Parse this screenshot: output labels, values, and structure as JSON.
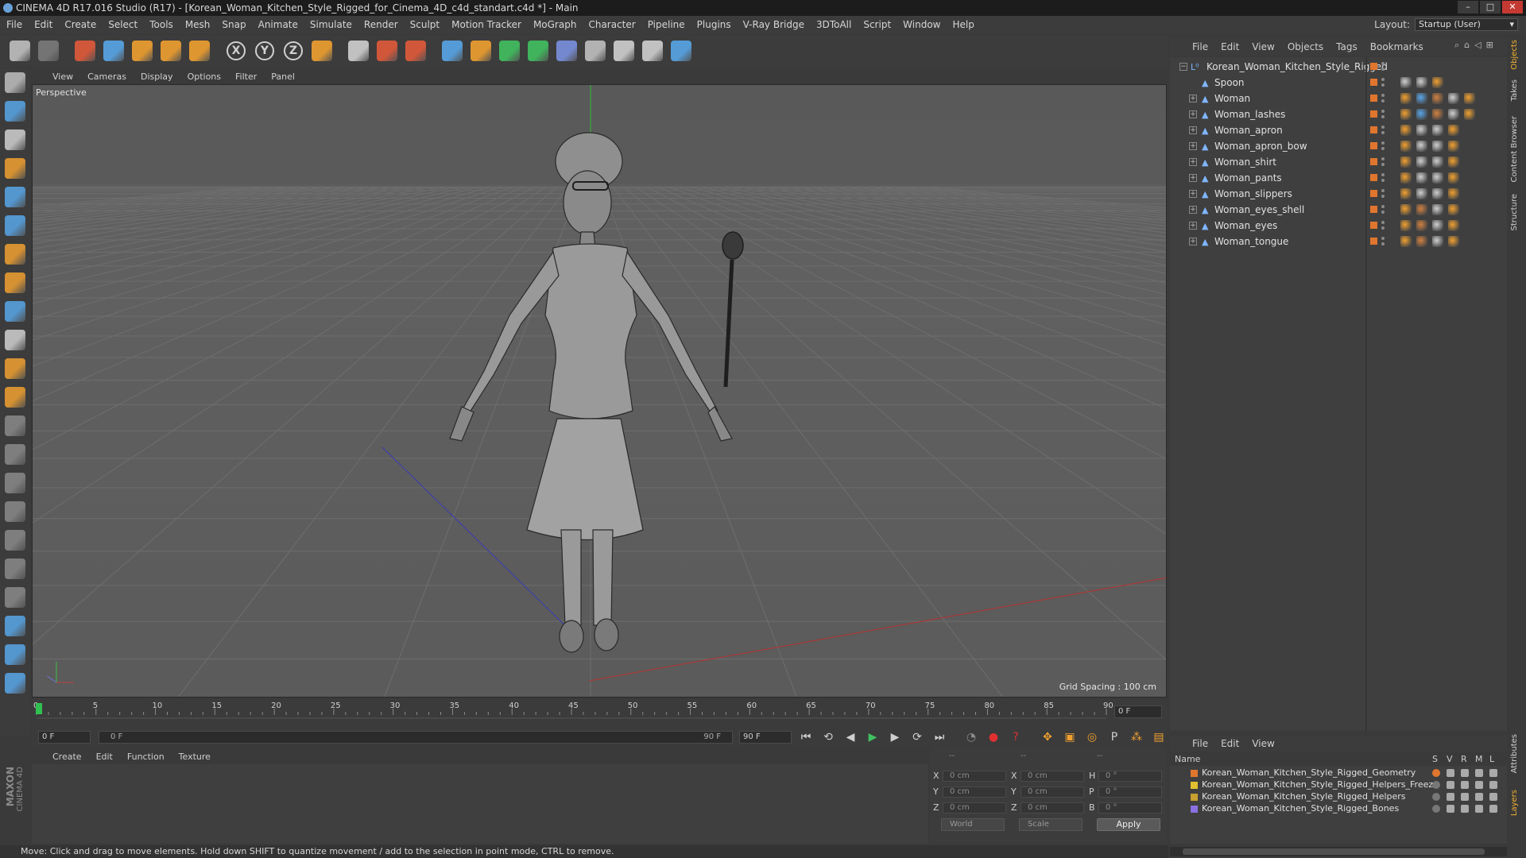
{
  "window": {
    "title": "CINEMA 4D R17.016 Studio (R17) - [Korean_Woman_Kitchen_Style_Rigged_for_Cinema_4D_c4d_standart.c4d *] - Main",
    "controls": [
      "minimize-icon",
      "maximize-icon",
      "close-icon"
    ]
  },
  "menubar": {
    "items": [
      "File",
      "Edit",
      "Create",
      "Select",
      "Tools",
      "Mesh",
      "Snap",
      "Animate",
      "Simulate",
      "Render",
      "Sculpt",
      "Motion Tracker",
      "MoGraph",
      "Character",
      "Pipeline",
      "Plugins",
      "V-Ray Bridge",
      "3DToAll",
      "Script",
      "Window",
      "Help"
    ],
    "layout_label": "Layout:",
    "layout_value": "Startup (User)"
  },
  "toolbar": {
    "tools": [
      {
        "name": "undo-icon",
        "color": "#bfbfbf"
      },
      {
        "name": "redo-icon",
        "color": "#7a7a7a"
      },
      {
        "name": "live-selection-icon",
        "color": "#e05a3a"
      },
      {
        "name": "move-icon",
        "color": "#58a6e8"
      },
      {
        "name": "scale-icon",
        "color": "#f0a030"
      },
      {
        "name": "rotate-icon",
        "color": "#f0a030"
      },
      {
        "name": "transform-icon",
        "color": "#f0a030"
      },
      {
        "name": "x-axis-icon",
        "color": "#d0d0d0",
        "glyph": "X"
      },
      {
        "name": "y-axis-icon",
        "color": "#d0d0d0",
        "glyph": "Y"
      },
      {
        "name": "z-axis-icon",
        "color": "#d0d0d0",
        "glyph": "Z"
      },
      {
        "name": "coordinate-system-icon",
        "color": "#f0a030"
      },
      {
        "name": "render-view-icon",
        "color": "#d0d0d0"
      },
      {
        "name": "render-picture-viewer-icon",
        "color": "#e05a3a"
      },
      {
        "name": "render-settings-icon",
        "color": "#e05a3a"
      },
      {
        "name": "cube-icon",
        "color": "#58a6e8"
      },
      {
        "name": "pen-spline-icon",
        "color": "#f0a030"
      },
      {
        "name": "subdivision-icon",
        "color": "#40c060"
      },
      {
        "name": "cloner-icon",
        "color": "#40c060"
      },
      {
        "name": "deformer-icon",
        "color": "#7a90e0"
      },
      {
        "name": "floor-icon",
        "color": "#bfbfbf"
      },
      {
        "name": "camera-icon",
        "color": "#d0d0d0"
      },
      {
        "name": "light-icon",
        "color": "#d0d0d0"
      },
      {
        "name": "python-icon",
        "color": "#58a6e8"
      }
    ]
  },
  "left_toolbar": {
    "tools": [
      {
        "name": "make-editable-icon",
        "color": "#bfbfbf"
      },
      {
        "name": "model-mode-icon",
        "color": "#58a6e8"
      },
      {
        "name": "texture-mode-icon",
        "color": "#d0d0d0"
      },
      {
        "name": "workplane-mode-icon",
        "color": "#f0a030"
      },
      {
        "name": "points-mode-icon",
        "color": "#58a6e8"
      },
      {
        "name": "edges-mode-icon",
        "color": "#58a6e8"
      },
      {
        "name": "polygons-mode-icon",
        "color": "#f0a030"
      },
      {
        "name": "axis-mode-icon",
        "color": "#f0a030"
      },
      {
        "name": "tweak-mode-icon",
        "color": "#58a6e8"
      },
      {
        "name": "snapping-icon",
        "color": "#d0d0d0"
      },
      {
        "name": "magnet-icon",
        "color": "#f0a030"
      },
      {
        "name": "joint-tool-icon",
        "color": "#f0a030"
      },
      {
        "name": "bone-tool-1-icon",
        "color": "#8a8a8a"
      },
      {
        "name": "bone-tool-2-icon",
        "color": "#8a8a8a"
      },
      {
        "name": "bone-tool-3-icon",
        "color": "#8a8a8a"
      },
      {
        "name": "bone-tool-4-icon",
        "color": "#8a8a8a"
      },
      {
        "name": "bone-tool-5-icon",
        "color": "#8a8a8a"
      },
      {
        "name": "bone-tool-6-icon",
        "color": "#8a8a8a"
      },
      {
        "name": "bone-tool-7-icon",
        "color": "#8a8a8a"
      },
      {
        "name": "lock-workplane-icon",
        "color": "#58a6e8"
      },
      {
        "name": "planar-workplane-icon",
        "color": "#58a6e8"
      },
      {
        "name": "python-script-icon",
        "color": "#58a6e8"
      }
    ]
  },
  "viewport": {
    "menu": [
      "View",
      "Cameras",
      "Display",
      "Options",
      "Filter",
      "Panel"
    ],
    "label": "Perspective",
    "grid_spacing": "Grid Spacing : 100 cm"
  },
  "timeline": {
    "ticks": [
      "0",
      "5",
      "10",
      "15",
      "20",
      "25",
      "30",
      "35",
      "40",
      "45",
      "50",
      "55",
      "60",
      "65",
      "70",
      "75",
      "80",
      "85",
      "90"
    ],
    "current_frame": "0 F",
    "start_field": "0 F",
    "range_start": "0 F",
    "range_end": "90 F",
    "end_field": "90 F",
    "playhead": 0,
    "max_frame": 90
  },
  "playback": {
    "buttons": [
      {
        "name": "go-to-start-icon",
        "color": "#cfcfcf",
        "glyph": "⏮"
      },
      {
        "name": "previous-key-icon",
        "color": "#cfcfcf",
        "glyph": "⟲"
      },
      {
        "name": "previous-frame-icon",
        "color": "#cfcfcf",
        "glyph": "◀"
      },
      {
        "name": "play-forward-icon",
        "color": "#40c060",
        "glyph": "▶"
      },
      {
        "name": "next-frame-icon",
        "color": "#cfcfcf",
        "glyph": "▶"
      },
      {
        "name": "next-key-icon",
        "color": "#cfcfcf",
        "glyph": "⟳"
      },
      {
        "name": "go-to-end-icon",
        "color": "#cfcfcf",
        "glyph": "⏭"
      },
      {
        "name": "record-motion-icon",
        "color": "#8a8a8a",
        "glyph": "◔"
      },
      {
        "name": "record-active-icon",
        "color": "#e03030",
        "glyph": "●"
      },
      {
        "name": "autokeying-icon",
        "color": "#e03030",
        "glyph": "?"
      },
      {
        "name": "key-position-icon",
        "color": "#f0a030",
        "glyph": "✥"
      },
      {
        "name": "key-scale-icon",
        "color": "#f0a030",
        "glyph": "▣"
      },
      {
        "name": "key-rotation-icon",
        "color": "#f0a030",
        "glyph": "◎"
      },
      {
        "name": "key-parameter-icon",
        "color": "#d0d0d0",
        "glyph": "P"
      },
      {
        "name": "key-pla-icon",
        "color": "#f0a030",
        "glyph": "⁂"
      },
      {
        "name": "timeline-window-icon",
        "color": "#f0a030",
        "glyph": "▤"
      }
    ]
  },
  "material": {
    "menu": [
      "Create",
      "Edit",
      "Function",
      "Texture"
    ]
  },
  "coordinates": {
    "headers": [
      "--",
      "--",
      "--"
    ],
    "rows": [
      {
        "l1": "X",
        "v1": "0 cm",
        "l2": "X",
        "v2": "0 cm",
        "l3": "H",
        "v3": "0 °"
      },
      {
        "l1": "Y",
        "v1": "0 cm",
        "l2": "Y",
        "v2": "0 cm",
        "l3": "P",
        "v3": "0 °"
      },
      {
        "l1": "Z",
        "v1": "0 cm",
        "l2": "Z",
        "v2": "0 cm",
        "l3": "B",
        "v3": "0 °"
      }
    ],
    "space": "World",
    "mode": "Scale",
    "apply": "Apply"
  },
  "status": {
    "text": "Move: Click and drag to move elements. Hold down SHIFT to quantize movement / add to the selection in point mode, CTRL to remove."
  },
  "logo": {
    "line1": "MAXON",
    "line2": "CINEMA 4D"
  },
  "object_manager": {
    "menu": [
      "File",
      "Edit",
      "View",
      "Objects",
      "Tags",
      "Bookmarks"
    ],
    "root": "Korean_Woman_Kitchen_Style_Rigged",
    "objects": [
      {
        "name": "Spoon",
        "expandable": false,
        "tags": [
          "#d0d0d0",
          "#d0d0d0",
          "#f0a030"
        ]
      },
      {
        "name": "Woman",
        "expandable": true,
        "tags": [
          "#f0a030",
          "#58a6e8",
          "#d08040",
          "#d0d0d0",
          "#f0a030"
        ]
      },
      {
        "name": "Woman_lashes",
        "expandable": true,
        "tags": [
          "#f0a030",
          "#58a6e8",
          "#d08040",
          "#d0d0d0",
          "#f0a030"
        ]
      },
      {
        "name": "Woman_apron",
        "expandable": true,
        "tags": [
          "#f0a030",
          "#d0d0d0",
          "#d0d0d0",
          "#f0a030"
        ]
      },
      {
        "name": "Woman_apron_bow",
        "expandable": true,
        "tags": [
          "#f0a030",
          "#d0d0d0",
          "#d0d0d0",
          "#f0a030"
        ]
      },
      {
        "name": "Woman_shirt",
        "expandable": true,
        "tags": [
          "#f0a030",
          "#d0d0d0",
          "#d0d0d0",
          "#f0a030"
        ]
      },
      {
        "name": "Woman_pants",
        "expandable": true,
        "tags": [
          "#f0a030",
          "#d0d0d0",
          "#d0d0d0",
          "#f0a030"
        ]
      },
      {
        "name": "Woman_slippers",
        "expandable": true,
        "tags": [
          "#f0a030",
          "#d0d0d0",
          "#d0d0d0",
          "#f0a030"
        ]
      },
      {
        "name": "Woman_eyes_shell",
        "expandable": true,
        "tags": [
          "#f0a030",
          "#d08040",
          "#d0d0d0",
          "#f0a030"
        ]
      },
      {
        "name": "Woman_eyes",
        "expandable": true,
        "tags": [
          "#f0a030",
          "#d08040",
          "#d0d0d0",
          "#f0a030"
        ]
      },
      {
        "name": "Woman_tongue",
        "expandable": true,
        "tags": [
          "#f0a030",
          "#d08040",
          "#d0d0d0",
          "#f0a030"
        ]
      }
    ]
  },
  "side_tabs": [
    "Objects",
    "Takes",
    "Content Browser",
    "Structure",
    "Attributes",
    "Layers"
  ],
  "layer_manager": {
    "menu": [
      "File",
      "Edit",
      "View"
    ],
    "columns": [
      "Name",
      "S",
      "V",
      "R",
      "M",
      "L"
    ],
    "layers": [
      {
        "name": "Korean_Woman_Kitchen_Style_Rigged_Geometry",
        "color": "#e0762e"
      },
      {
        "name": "Korean_Woman_Kitchen_Style_Rigged_Helpers_Freeze",
        "color": "#e0c030"
      },
      {
        "name": "Korean_Woman_Kitchen_Style_Rigged_Helpers",
        "color": "#c8a030"
      },
      {
        "name": "Korean_Woman_Kitchen_Style_Rigged_Bones",
        "color": "#8a70e0"
      }
    ]
  }
}
